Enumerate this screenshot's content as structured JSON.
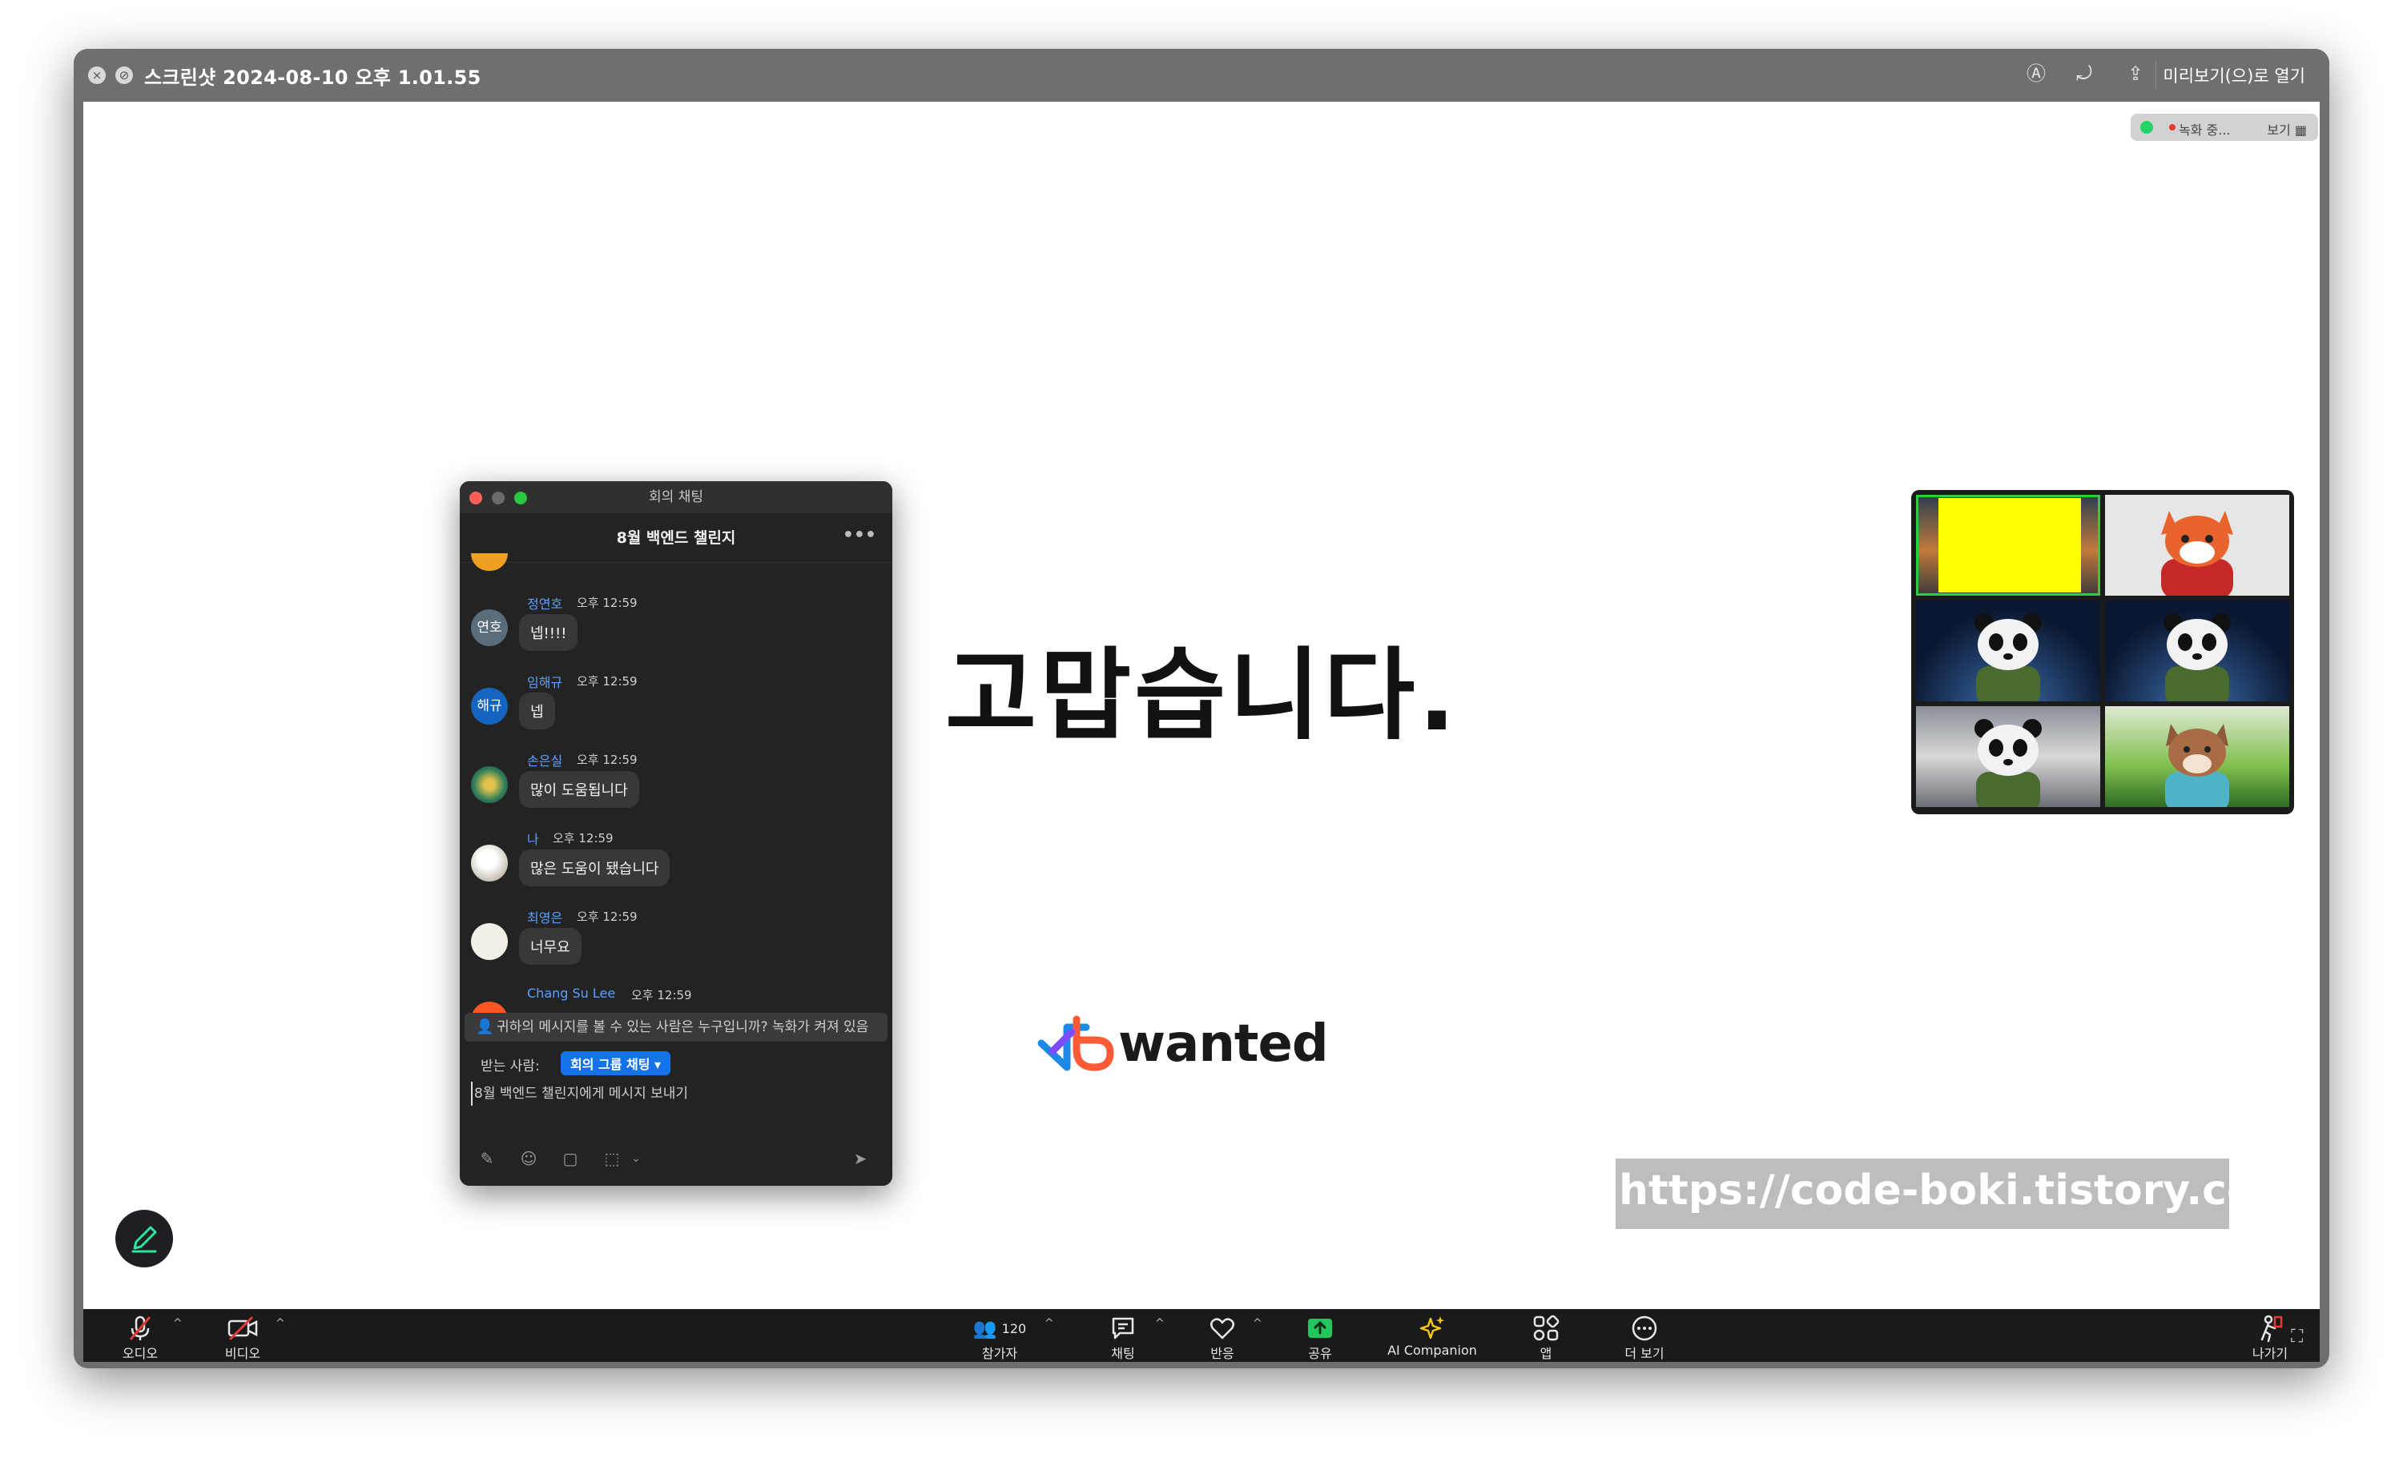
{
  "window": {
    "title": "스크린샷 2024-08-10 오후 1.01.55",
    "open_with": "미리보기(으)로 열기"
  },
  "recording": {
    "status": "녹화 중...",
    "view_label": "보기"
  },
  "slide": {
    "heading": "고맙습니다.",
    "logo_text": "wanted",
    "watermark_url": "https://code-boki.tistory.com"
  },
  "chat": {
    "window_title": "회의 채팅",
    "group_name": "8월 백엔드 챌린지",
    "messages": [
      {
        "name": "정연호",
        "time": "오후 12:59",
        "text": "넵!!!!",
        "avatar": "연호",
        "avatar_color": "#5b6c7a"
      },
      {
        "name": "임해규",
        "time": "오후 12:59",
        "text": "넵",
        "avatar": "해규",
        "avatar_color": "#1565c0"
      },
      {
        "name": "손은실",
        "time": "오후 12:59",
        "text": "많이 도움됩니다",
        "avatar": "",
        "avatar_color": "#2e7d5b"
      },
      {
        "name": "나",
        "time": "오후 12:59",
        "text": "많은 도움이 됐습니다",
        "avatar": "",
        "avatar_color": "#d9d2c8"
      },
      {
        "name": "최영은",
        "time": "오후 12:59",
        "text": "너무요",
        "avatar": "",
        "avatar_color": "#f2efe6"
      },
      {
        "name": "Chang Su Lee",
        "time": "오후 12:59",
        "text": "",
        "avatar": "",
        "avatar_color": "#ff5722"
      }
    ],
    "notice": "귀하의 메시지를 볼 수 있는 사람은 누구입니까? 녹화가 켜져 있음",
    "to_label": "받는 사람:",
    "to_value": "회의 그룹 채팅",
    "input_placeholder": "8월 백엔드 챌린지에게 메시지 보내기"
  },
  "toolbar": {
    "audio": "오디오",
    "video": "비디오",
    "participants": "참가자",
    "participant_count": "120",
    "chat": "채팅",
    "reactions": "반응",
    "share": "공유",
    "ai": "AI Companion",
    "apps": "앱",
    "more": "더 보기",
    "leave": "나가기"
  },
  "colors": {
    "share_green": "#22c55e",
    "ai_yellow": "#f5c518",
    "mute_red": "#e53935",
    "chat_blue": "#1473e6"
  }
}
